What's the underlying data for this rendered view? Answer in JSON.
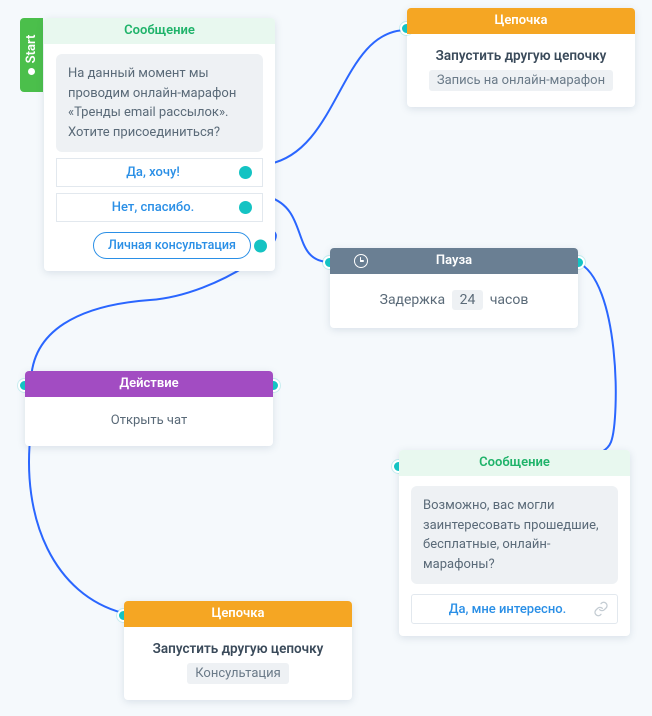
{
  "start_label": "Start",
  "nodes": {
    "msg1": {
      "title": "Сообщение",
      "bubble": "На данный момент мы проводим онлайн-марафон «Тренды email рассылок». Хотите присоединиться?",
      "opt_yes": "Да, хочу!",
      "opt_no": "Нет, спасибо.",
      "pill": "Личная консультация"
    },
    "chain_top": {
      "title": "Цепочка",
      "heading": "Запустить другую цепочку",
      "chip": "Запись на онлайн-марафон"
    },
    "pause": {
      "title": "Пауза",
      "delay_label_pre": "Задержка",
      "delay_value": "24",
      "delay_label_post": "часов"
    },
    "action": {
      "title": "Действие",
      "body": "Открыть чат"
    },
    "msg2": {
      "title": "Сообщение",
      "bubble": "Возможно, вас могли заинтересовать прошедшие, бесплатные, онлайн-марафоны?",
      "opt": "Да, мне интересно."
    },
    "chain_bottom": {
      "title": "Цепочка",
      "heading": "Запустить другую цепочку",
      "chip": "Консультация"
    }
  }
}
